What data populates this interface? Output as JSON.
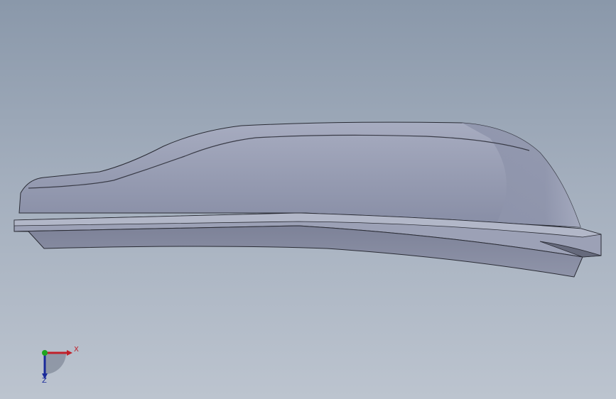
{
  "viewport": {
    "background_top": "#8a98aa",
    "background_bottom": "#bcc4cf",
    "model_color": "#8f95ac"
  },
  "triad": {
    "x_label": "X",
    "z_label": "Z",
    "x_color": "#c0202a",
    "y_color": "#1fa51f",
    "z_color": "#1a2a9a"
  }
}
